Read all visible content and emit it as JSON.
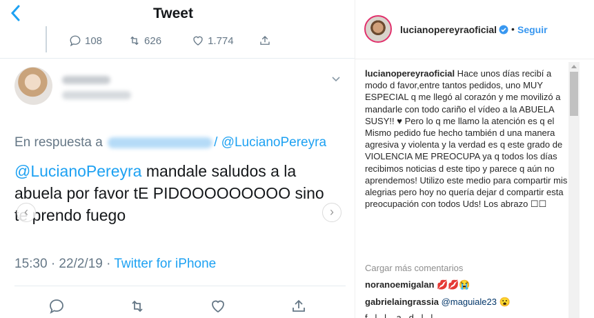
{
  "tweet": {
    "title": "Tweet",
    "back_icon": "chevron-left-icon",
    "prev_stats": {
      "replies": "108",
      "retweets": "626",
      "likes": "1.774"
    },
    "reply_prefix": "En respuesta a",
    "reply_link": "/ @LucianoPereyra",
    "body_mention": "@LucianoPereyra",
    "body_text": " mandale saludos a la abuela por favor tE PIDOOOOOOOOO sino te prendo fuego",
    "time": "15:30 · 22/2/19 ·",
    "source": "Twitter for iPhone",
    "colors": {
      "accent": "#1da1f2",
      "muted": "#657786"
    }
  },
  "instagram": {
    "username": "lucianopereyraoficial",
    "separator": "•",
    "follow_label": "Seguir",
    "caption_user": "lucianopereyraoficial",
    "caption": " Hace unos días recibí a modo d favor,entre tantos pedidos, uno MUY ESPECIAL q me llegó al corazón y me movilizó a mandarle con todo cariño el vídeo a la ABUELA SUSY!! ♥ Pero lo q me llamo la atención es q el Mismo pedido fue hecho también d una manera agresiva y violenta y la verdad es q este grado de VIOLENCIA ME PREOCUPA ya q todos los días recibimos noticias d este tipo y parece q aún no aprendemos! Utilizo este medio para compartir mis alegrias pero hoy no quería dejar d compartir esta preocupación con todos Uds! Los abrazo ☐☐",
    "load_more": "Cargar más comentarios",
    "comments": [
      {
        "user": "noranoemigalan",
        "text": " 💋💋😭"
      },
      {
        "user": "gabrielaingrassia",
        "mention": "@maguiale23",
        "text": " 😮"
      },
      {
        "user": "",
        "text": "f...l...l....a...d...l...l"
      }
    ],
    "colors": {
      "link": "#3897f0",
      "verified": "#3897f0"
    }
  }
}
